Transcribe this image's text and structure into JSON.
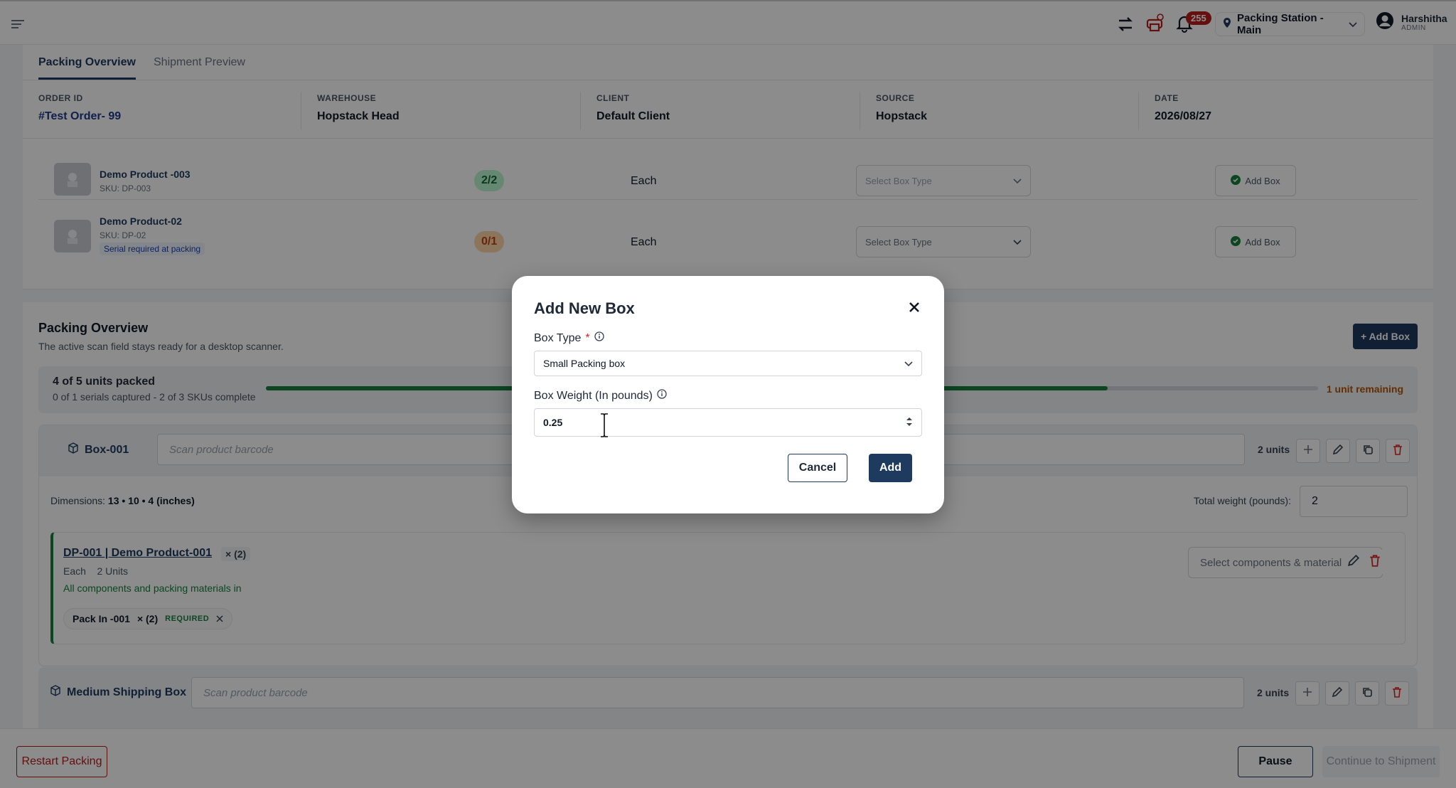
{
  "header": {
    "notifications_count": "255",
    "station_label": "Packing Station - Main",
    "user_name": "Harshitha",
    "user_role": "ADMIN"
  },
  "tabs": [
    {
      "label": "Packing Overview"
    },
    {
      "label": "Shipment Preview"
    }
  ],
  "order": {
    "order_id_label": "ORDER ID",
    "order_id": "#Test Order- 99",
    "warehouse_label": "WAREHOUSE",
    "warehouse": "Hopstack Head",
    "client_label": "CLIENT",
    "client": "Default Client",
    "source_label": "SOURCE",
    "source": "Hopstack",
    "date_label": "DATE",
    "date": "2026/08/27"
  },
  "products": [
    {
      "name": "Demo Product -003",
      "sku": "SKU: DP-003",
      "qty": "2/2",
      "uom": "Each",
      "select_placeholder": "Select Box Type",
      "add_label": "Add Box",
      "tag": ""
    },
    {
      "name": "Demo Product-02",
      "sku": "SKU: DP-02",
      "qty": "0/1",
      "uom": "Each",
      "select_placeholder": "Select Box Type",
      "add_label": "Add Box",
      "tag": "Serial required at packing"
    }
  ],
  "overview": {
    "title": "Packing Overview",
    "subtitle": "The active scan field stays ready for a desktop scanner.",
    "add_box_label": "+ Add Box",
    "progress_title": "4 of 5 units packed",
    "progress_sub": "0 of 1 serials captured - 2 of 3 SKUs complete",
    "progress_fraction": 0.8,
    "remaining": "1 unit remaining"
  },
  "box1": {
    "name": "Box-001",
    "scan_placeholder": "Scan product barcode",
    "units": "2 units",
    "dims_label": "Dimensions:",
    "dims_value": "13 • 10 • 4 (inches)",
    "total_weight_label": "Total weight (pounds):",
    "total_weight": "2",
    "item": {
      "title": "DP-001 | Demo Product-001",
      "count": "× (2)",
      "meta": "Each    2 Units",
      "status": "All components and packing materials in",
      "chip_name": "Pack In -001",
      "chip_count": "× (2)",
      "chip_req": "REQUIRED",
      "components_placeholder": "Select components & materials"
    }
  },
  "box2": {
    "name": "Medium Shipping Box",
    "scan_placeholder": "Scan product barcode",
    "units": "2 units"
  },
  "footer": {
    "restart_label": "Restart Packing",
    "pause_label": "Pause",
    "continue_label": "Continue to Shipment"
  },
  "modal": {
    "title": "Add New Box",
    "box_type_label": "Box Type",
    "required_mark": "*",
    "box_type_value": "Small Packing box",
    "weight_label": "Box Weight (In pounds)",
    "weight_value": "0.25",
    "cancel_label": "Cancel",
    "add_label": "Add"
  },
  "colors": {
    "primary": "#1e3a5f",
    "success": "#15803d",
    "danger": "#b91c1c",
    "warning": "#b45309"
  }
}
